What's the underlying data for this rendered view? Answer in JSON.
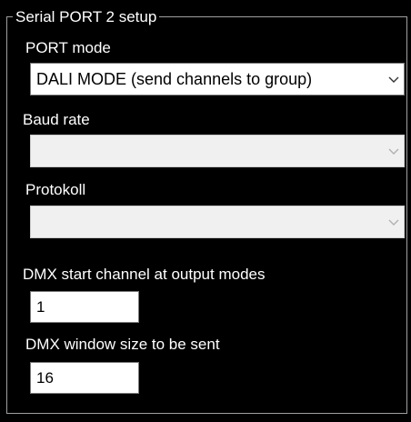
{
  "group": {
    "title": "Serial PORT 2 setup"
  },
  "port_mode": {
    "label": "PORT mode",
    "selected": "DALI MODE (send channels to group)"
  },
  "baud_rate": {
    "label": "Baud rate",
    "selected": ""
  },
  "protokoll": {
    "label": "Protokoll",
    "selected": ""
  },
  "dmx_start": {
    "label": "DMX start channel at output modes",
    "value": "1"
  },
  "dmx_window": {
    "label": "DMX window size to be sent",
    "value": "16"
  },
  "icons": {
    "dropdown": "chevron-down-icon"
  },
  "colors": {
    "background": "#000000",
    "text": "#ffffff",
    "field": "#ffffff",
    "disabled_field": "#f0f0f0"
  }
}
